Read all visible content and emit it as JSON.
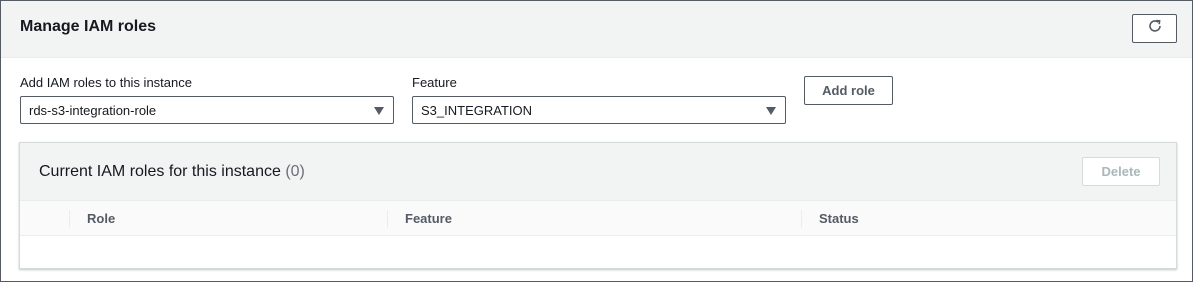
{
  "panel": {
    "title": "Manage IAM roles",
    "refresh_icon": "refresh-icon"
  },
  "form": {
    "role_label": "Add IAM roles to this instance",
    "role_value": "rds-s3-integration-role",
    "feature_label": "Feature",
    "feature_value": "S3_INTEGRATION",
    "add_button": "Add role"
  },
  "roles_table": {
    "title": "Current IAM roles for this instance",
    "count": "(0)",
    "delete_button": "Delete",
    "columns": [
      "Role",
      "Feature",
      "Status"
    ],
    "rows": []
  },
  "colors": {
    "header_bg": "#f2f3f3",
    "border_dark": "#545b64",
    "text_primary": "#16191f",
    "text_disabled": "#aab7b8"
  }
}
